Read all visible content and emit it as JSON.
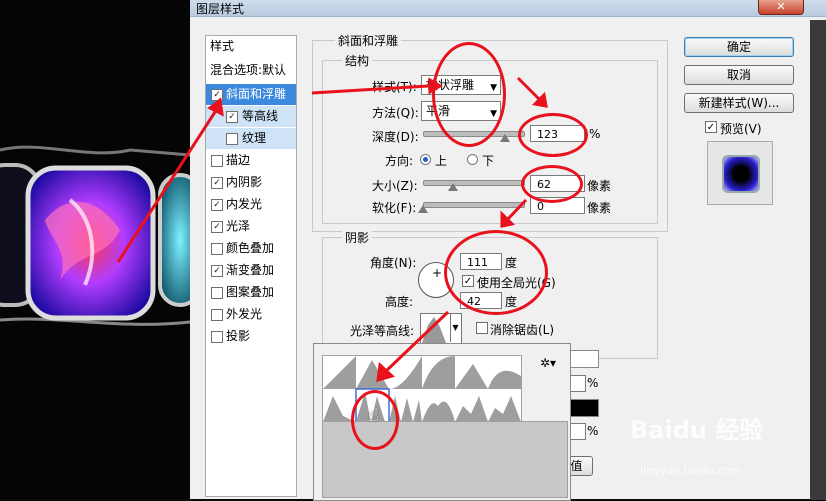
{
  "window": {
    "title": "图层样式",
    "close_label": "✕"
  },
  "style_list": {
    "header": "样式",
    "items": [
      {
        "label": "混合选项:默认",
        "has_checkbox": false,
        "checked": false,
        "state": "normal"
      },
      {
        "label": "斜面和浮雕",
        "has_checkbox": true,
        "checked": true,
        "state": "selected"
      },
      {
        "label": "等高线",
        "has_checkbox": true,
        "checked": true,
        "state": "sub-selected"
      },
      {
        "label": "纹理",
        "has_checkbox": true,
        "checked": false,
        "state": "sub"
      },
      {
        "label": "描边",
        "has_checkbox": true,
        "checked": false,
        "state": "normal"
      },
      {
        "label": "内阴影",
        "has_checkbox": true,
        "checked": true,
        "state": "normal"
      },
      {
        "label": "内发光",
        "has_checkbox": true,
        "checked": true,
        "state": "normal"
      },
      {
        "label": "光泽",
        "has_checkbox": true,
        "checked": true,
        "state": "normal"
      },
      {
        "label": "颜色叠加",
        "has_checkbox": true,
        "checked": false,
        "state": "normal"
      },
      {
        "label": "渐变叠加",
        "has_checkbox": true,
        "checked": true,
        "state": "normal"
      },
      {
        "label": "图案叠加",
        "has_checkbox": true,
        "checked": false,
        "state": "normal"
      },
      {
        "label": "外发光",
        "has_checkbox": true,
        "checked": false,
        "state": "normal"
      },
      {
        "label": "投影",
        "has_checkbox": true,
        "checked": false,
        "state": "normal"
      }
    ]
  },
  "bevel": {
    "group_title": "斜面和浮雕",
    "structure_title": "结构",
    "style_label": "样式(T):",
    "style_value": "枕状浮雕",
    "technique_label": "方法(Q):",
    "technique_value": "平滑",
    "depth_label": "深度(D):",
    "depth_value": "123",
    "depth_unit": "%",
    "direction_label": "方向:",
    "direction_up": "上",
    "direction_down": "下",
    "size_label": "大小(Z):",
    "size_value": "62",
    "size_unit": "像素",
    "soften_label": "软化(F):",
    "soften_value": "0",
    "soften_unit": "像素"
  },
  "shading": {
    "title": "阴影",
    "angle_label": "角度(N):",
    "angle_value": "111",
    "angle_unit": "度",
    "global_light_label": "使用全局光(G)",
    "altitude_label": "高度:",
    "altitude_value": "42",
    "altitude_unit": "度",
    "gloss_contour_label": "光泽等高线:",
    "anti_alias_label": "消除锯齿(L)"
  },
  "hidden_fields": {
    "opacity_unit_1": "%",
    "opacity_unit_2": "%",
    "partial_button": "值"
  },
  "buttons": {
    "ok": "确定",
    "cancel": "取消",
    "new_style": "新建样式(W)...",
    "preview_label": "预览(V)"
  },
  "watermark": {
    "brand": "Baidu 经验",
    "url": "jingyan.baidu.com"
  },
  "colors": {
    "accent_red": "#e8111c",
    "selection": "#3b89df",
    "preview_blue": "#2b1fd0"
  },
  "icons": {
    "gear": "gear-icon",
    "cursor": "hand-cursor-icon"
  }
}
